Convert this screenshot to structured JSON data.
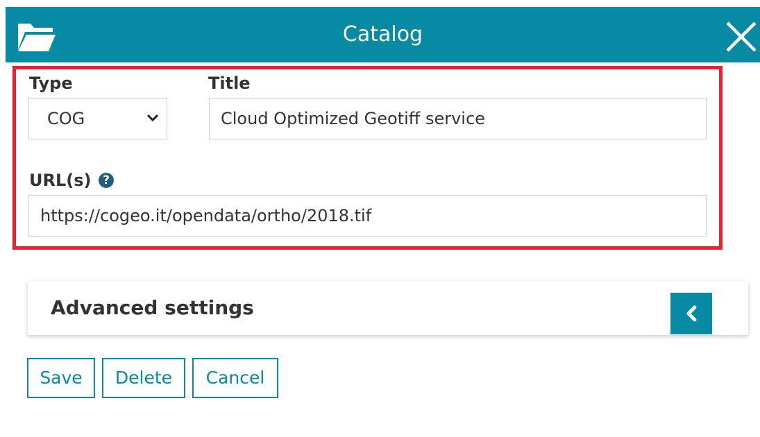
{
  "header": {
    "title": "Catalog",
    "folder_icon": "folder-open-icon",
    "close_icon": "close-icon",
    "color": "#078aa3"
  },
  "form": {
    "type": {
      "label": "Type",
      "value": "COG"
    },
    "title": {
      "label": "Title",
      "value": "Cloud Optimized Geotiff service"
    },
    "url": {
      "label": "URL(s)",
      "value": "https://cogeo.it/opendata/ortho/2018.tif",
      "help_icon": "question-circle-icon"
    },
    "highlight_color": "#e8232e"
  },
  "advanced": {
    "title": "Advanced settings",
    "toggle_icon": "chevron-left-icon"
  },
  "buttons": {
    "save": "Save",
    "delete": "Delete",
    "cancel": "Cancel"
  }
}
